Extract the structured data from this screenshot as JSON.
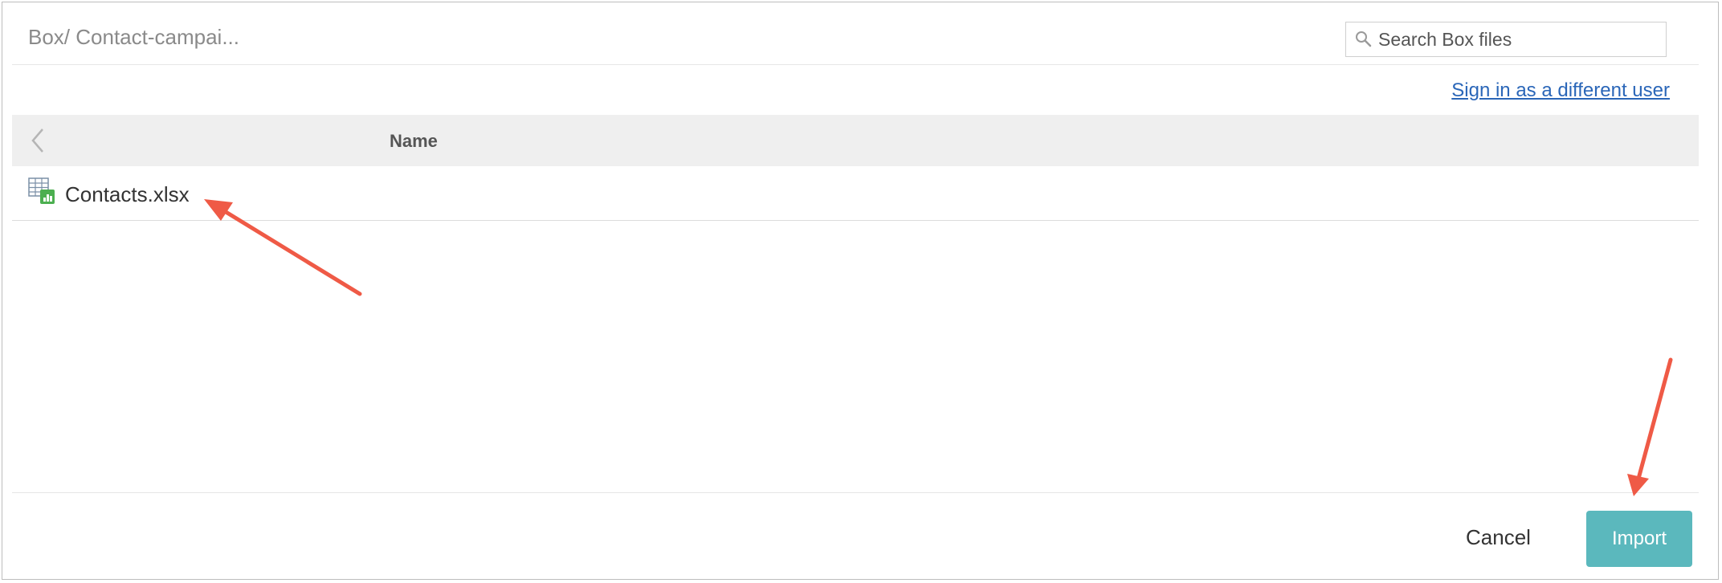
{
  "breadcrumb": "Box/ Contact-campai...",
  "search": {
    "placeholder": "Search Box files",
    "value": "",
    "icon": "search-icon"
  },
  "signin_link": "Sign in as a different user",
  "table": {
    "columns": [
      "Name"
    ],
    "rows": [
      {
        "name": "Contacts.xlsx",
        "icon": "spreadsheet-file-icon"
      }
    ]
  },
  "footer": {
    "cancel_label": "Cancel",
    "import_label": "Import"
  },
  "colors": {
    "accent": "#5bb8bd",
    "link": "#2a66b8",
    "annotation_arrow": "#ef5a46"
  }
}
